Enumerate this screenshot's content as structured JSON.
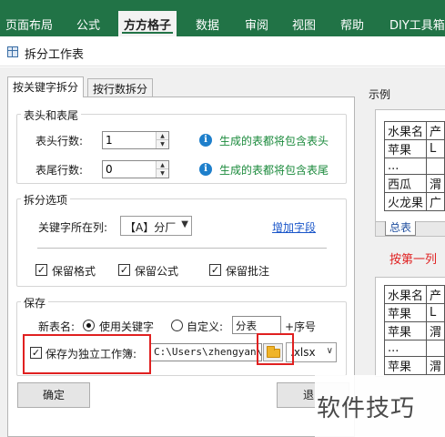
{
  "ribbon": {
    "tabs": [
      "页面布局",
      "公式",
      "方方格子",
      "数据",
      "审阅",
      "视图",
      "帮助",
      "DIY工具箱"
    ],
    "active_tab": "方方格子",
    "colors": {
      "ribbon": "#217346"
    }
  },
  "dialog": {
    "title": "拆分工作表",
    "icon": "app-grid-icon",
    "tabs": [
      "按关键字拆分",
      "按行数拆分"
    ],
    "active_tab": "按关键字拆分",
    "header_footer": {
      "group_label": "表头和表尾",
      "header_rows_label": "表头行数:",
      "header_rows_value": "1",
      "header_hint": "生成的表都将包含表头",
      "footer_rows_label": "表尾行数:",
      "footer_rows_value": "0",
      "footer_hint": "生成的表都将包含表尾"
    },
    "split_options": {
      "group_label": "拆分选项",
      "key_column_label": "关键字所在列:",
      "key_column_value": "【A】分厂",
      "add_field_link": "增加字段",
      "keep_format": {
        "label": "保留格式",
        "checked": true
      },
      "keep_formula": {
        "label": "保留公式",
        "checked": true
      },
      "keep_comment": {
        "label": "保留批注",
        "checked": true
      }
    },
    "save": {
      "group_label": "保存",
      "new_name_label": "新表名:",
      "use_keyword": {
        "label": "使用关键字",
        "selected": true
      },
      "custom": {
        "label": "自定义:",
        "selected": false,
        "value": "分表"
      },
      "suffix_label": "+序号",
      "save_separate": {
        "label": "保存为独立工作簿:",
        "checked": true
      },
      "path_value": "C:\\Users\\zhengyan\\De",
      "extension": ".xlsx"
    },
    "buttons": {
      "ok": "确定",
      "cancel_partial": "退"
    }
  },
  "sample": {
    "label": "示例",
    "table1": {
      "rows": [
        [
          "水果名",
          "产"
        ],
        [
          "苹果",
          "L"
        ],
        [
          "...",
          ""
        ],
        [
          "西瓜",
          "渭"
        ],
        [
          "火龙果",
          "广"
        ]
      ],
      "sheet_tab": "总表"
    },
    "caption": "按第一列",
    "table2": {
      "rows": [
        [
          "水果名",
          "产"
        ],
        [
          "苹果",
          "L"
        ],
        [
          "苹果",
          "渭"
        ],
        [
          "...",
          ""
        ],
        [
          "苹果",
          "渭"
        ]
      ]
    }
  },
  "watermark": "软件技巧",
  "colors": {
    "hint_green": "#1b8a3c",
    "annotation_red": "#e02020",
    "link_blue": "#1a56c9"
  }
}
